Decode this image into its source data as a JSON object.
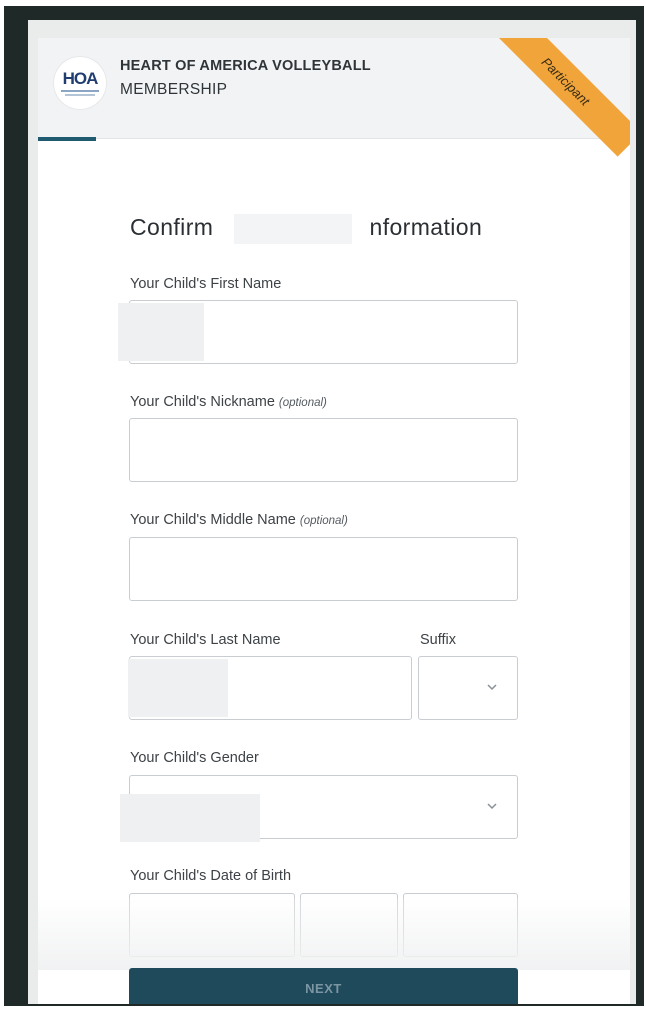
{
  "header": {
    "logo_text": "HOA",
    "org_name": "HEART OF AMERICA VOLLEYBALL",
    "section": "MEMBERSHIP"
  },
  "ribbon": {
    "label": "Participant"
  },
  "form": {
    "title_start": "Confirm",
    "title_end": "nformation",
    "first_name_label": "Your Child's First Name",
    "nickname_label": "Your Child's Nickname",
    "nickname_optional": "(optional)",
    "middle_name_label": "Your Child's Middle Name",
    "middle_name_optional": "(optional)",
    "last_name_label": "Your Child's Last Name",
    "suffix_label": "Suffix",
    "gender_label": "Your Child's Gender",
    "dob_label": "Your Child's Date of Birth"
  },
  "actions": {
    "next_label": "NEXT"
  },
  "colors": {
    "ribbon": "#f0a43a",
    "primary_button": "#1e4a5c",
    "progress_tab": "#1f5a70"
  },
  "icons": {
    "logo": "hoa-logo",
    "select_arrow": "chevron-down-icon"
  }
}
